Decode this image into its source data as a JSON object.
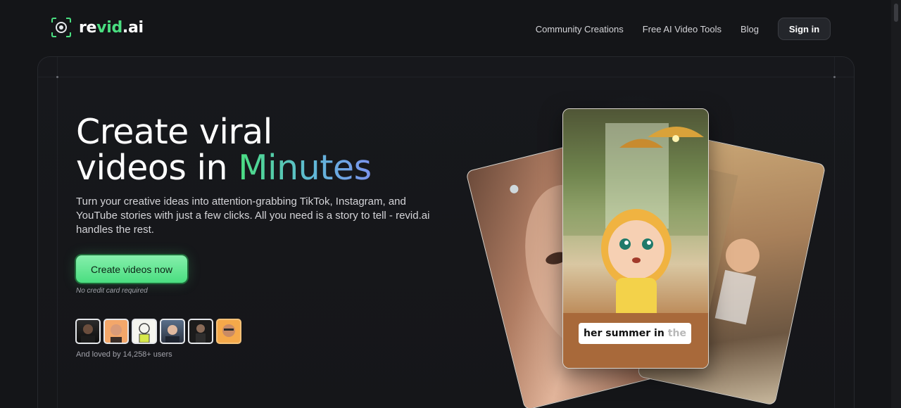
{
  "logo": {
    "prefix": "re",
    "accent": "vid",
    "suffix": ".ai"
  },
  "nav": {
    "links": [
      "Community Creations",
      "Free AI Video Tools",
      "Blog"
    ],
    "signin_label": "Sign in"
  },
  "hero": {
    "title_line1": "Create viral",
    "title_line2_prefix": "videos in ",
    "title_line2_accent": "Minutes",
    "subtitle": "Turn your creative ideas into attention-grabbing TikTok, Instagram, and YouTube stories with just a few clicks. All you need is a story to tell - revid.ai handles the rest.",
    "cta_label": "Create videos now",
    "note": "No credit card required",
    "avatar_count": 6,
    "loved_text": "And loved by 14,258+ users"
  },
  "preview": {
    "caption_words": "her summer in",
    "caption_dim": "the"
  },
  "colors": {
    "background": "#141518",
    "accent_green": "#4ade80",
    "accent_blue": "#7b93ef"
  },
  "icons": [
    "camera-logo-icon"
  ]
}
